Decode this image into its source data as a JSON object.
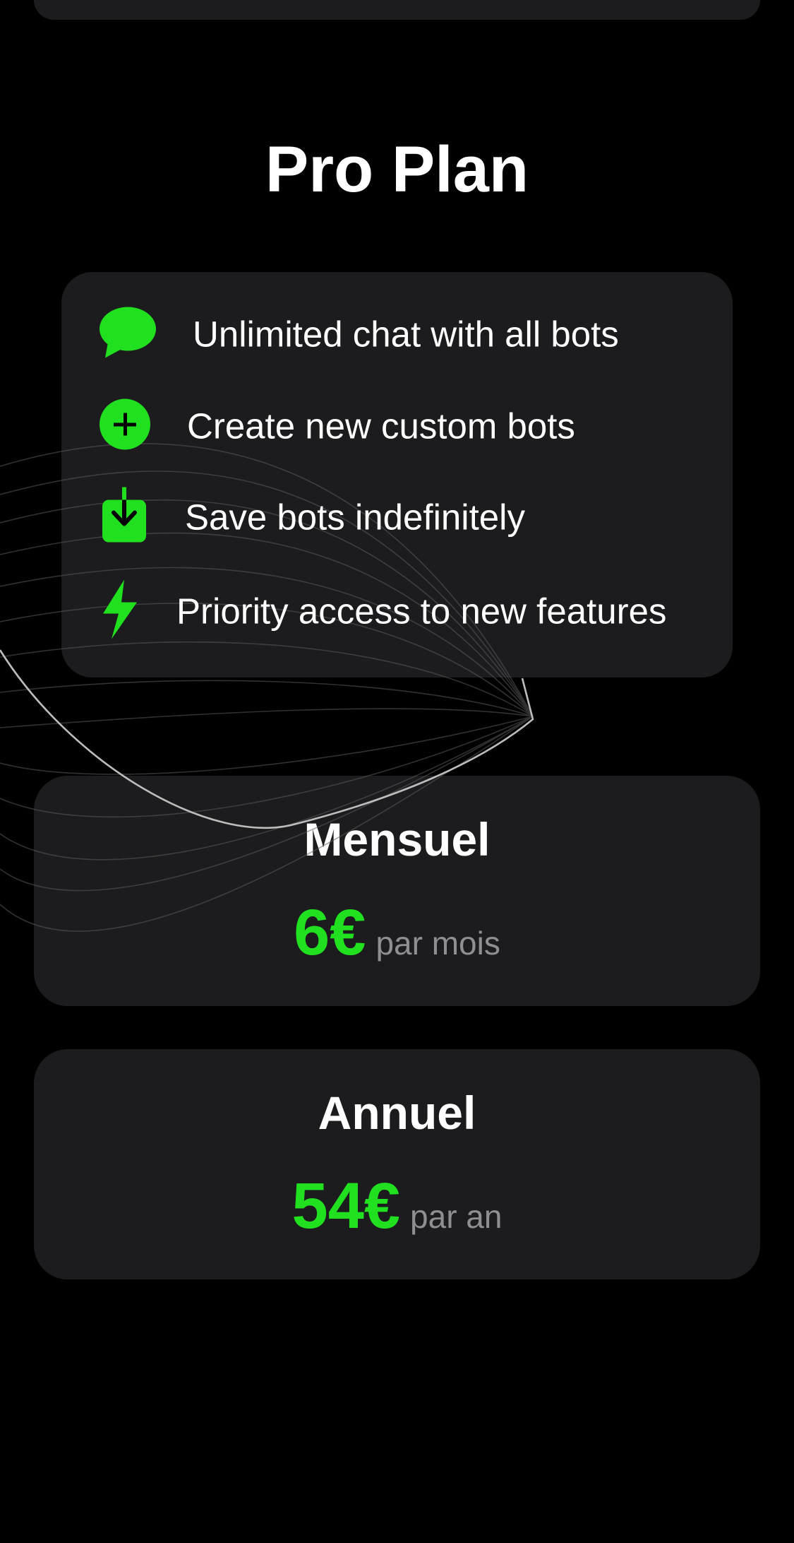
{
  "title": "Pro Plan",
  "colors": {
    "accent": "#20e01f",
    "card": "#1c1c1e",
    "background": "#000000",
    "muted_text": "#8e8e93"
  },
  "features": [
    {
      "icon": "chat-bubble-icon",
      "label": "Unlimited chat with all bots"
    },
    {
      "icon": "plus-circle-icon",
      "label": "Create new custom bots"
    },
    {
      "icon": "download-box-icon",
      "label": "Save bots indefinitely"
    },
    {
      "icon": "lightning-bolt-icon",
      "label": "Priority access to new features"
    }
  ],
  "plans": [
    {
      "name": "Mensuel",
      "price": "6€",
      "period": "par mois"
    },
    {
      "name": "Annuel",
      "price": "54€",
      "period": "par an"
    }
  ]
}
